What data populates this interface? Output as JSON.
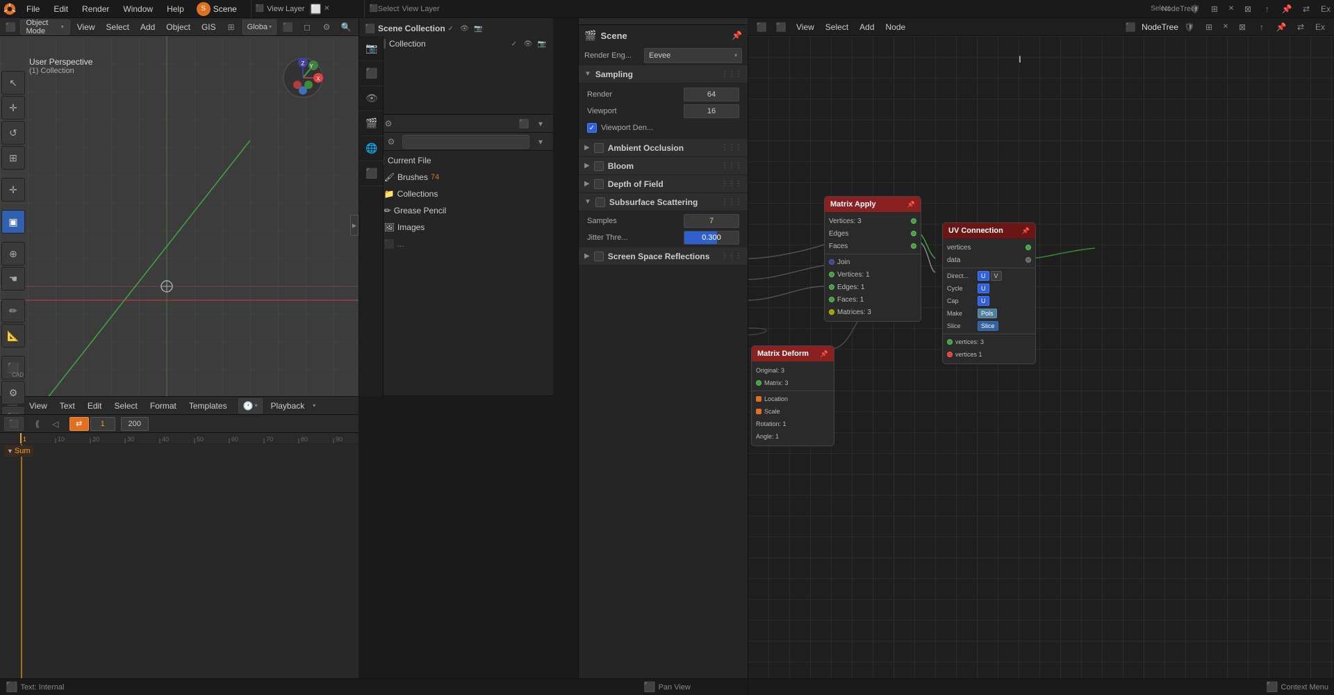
{
  "app": {
    "title": "Blender"
  },
  "top_menu": {
    "items": [
      "File",
      "Edit",
      "Render",
      "Window",
      "Help"
    ]
  },
  "viewport": {
    "mode": "Object Mode",
    "view_label": "User Perspective",
    "collection": "(1) Collection",
    "header_tabs": [
      "View",
      "Select",
      "Add",
      "Object",
      "GIS"
    ],
    "transform_mode": "Global"
  },
  "outliner": {
    "title": "Scene Collection",
    "header_label": "View Layer",
    "items": [
      {
        "label": "Scene Collection",
        "indent": 0,
        "icon": "📦"
      },
      {
        "label": "Collection",
        "indent": 1,
        "icon": "📁"
      }
    ]
  },
  "asset_browser": {
    "search_placeholder": "",
    "current_file_label": "Current File",
    "items": [
      {
        "label": "Brushes",
        "count": "74",
        "indent": 1
      },
      {
        "label": "Collections",
        "indent": 1
      },
      {
        "label": "Grease Pencil",
        "indent": 1
      },
      {
        "label": "Images",
        "indent": 1
      }
    ]
  },
  "render_props": {
    "scene_label": "Scene",
    "render_engine_label": "Render Eng...",
    "render_engine_value": "Eevee",
    "sections": {
      "sampling": {
        "label": "Sampling",
        "render_label": "Render",
        "render_value": "64",
        "viewport_label": "Viewport",
        "viewport_value": "16",
        "viewport_denoising_label": "Viewport Den...",
        "viewport_denoising_checked": true
      },
      "ambient_occlusion": {
        "label": "Ambient Occlusion",
        "enabled": false
      },
      "bloom": {
        "label": "Bloom",
        "enabled": false
      },
      "depth_of_field": {
        "label": "Depth of Field",
        "enabled": false
      },
      "subsurface_scattering": {
        "label": "Subsurface Scattering",
        "enabled": true,
        "samples_label": "Samples",
        "samples_value": "7",
        "jitter_label": "Jitter Thre...",
        "jitter_value": "0.300"
      },
      "screen_space_reflections": {
        "label": "Screen Space Reflections",
        "enabled": false
      }
    }
  },
  "node_editor": {
    "header_items": [
      "View",
      "Select",
      "Add",
      "Node"
    ],
    "title": "NodeTree",
    "nodes": {
      "matrix_apply": {
        "title": "Matrix Apply",
        "sockets_out": [
          "Vertices: 3",
          "Edges",
          "Faces"
        ],
        "sockets_in": [
          "Join",
          "Vertices: 1",
          "Edges: 1",
          "Faces: 1",
          "Matrices: 3"
        ]
      },
      "uv_connection": {
        "title": "UV Connection",
        "sockets_out": [
          "vertices",
          "data"
        ],
        "fields": [
          "Direct...",
          "U",
          "V",
          "Cycle",
          "U",
          "Cap",
          "U",
          "Make",
          "Pols",
          "Slice",
          "Slice"
        ],
        "sockets_in": [
          "vertices: 3",
          "vertices 1"
        ]
      },
      "matrix_deform": {
        "title": "Matrix Deform",
        "fields": [
          "Original: 3",
          "Matrix: 3"
        ],
        "sockets_out": [
          "Location",
          "Scale",
          "Rotation: 1",
          "Angle: 1"
        ]
      }
    }
  },
  "timeline": {
    "header_items": [
      "View",
      "Text",
      "Edit",
      "Select",
      "Format",
      "Templates"
    ],
    "playback_label": "Playback",
    "frame_start": "1",
    "frame_end": "200",
    "frame_current": "1",
    "marker_label": "Sum"
  },
  "status_bar": {
    "left_text": "Text: Internal",
    "right_text": "Pan View",
    "context_menu": "Context Menu"
  }
}
